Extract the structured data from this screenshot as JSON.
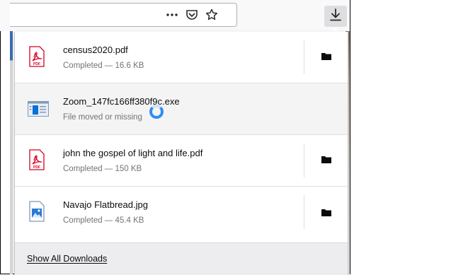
{
  "toolbar": {
    "icons": [
      "more-actions-icon",
      "pocket-icon",
      "bookmark-star-icon",
      "downloads-icon"
    ]
  },
  "downloads": [
    {
      "name": "census2020.pdf",
      "status": "Completed — 16.6 KB",
      "type": "pdf",
      "has_folder": true
    },
    {
      "name": "Zoom_147fc166ff380f9c.exe",
      "status": "File moved or missing",
      "type": "exe",
      "has_folder": false
    },
    {
      "name": "john the gospel of light and life.pdf",
      "status": "Completed — 150 KB",
      "type": "pdf",
      "has_folder": true
    },
    {
      "name": "Navajo Flatbread.jpg",
      "status": "Completed — 45.4 KB",
      "type": "jpg",
      "has_folder": true
    }
  ],
  "footer": {
    "label": "Show All Downloads"
  },
  "colors": {
    "pdf_red": "#d70022",
    "accent_blue": "#0a84ff",
    "spinner_blue": "#2f8df5"
  }
}
